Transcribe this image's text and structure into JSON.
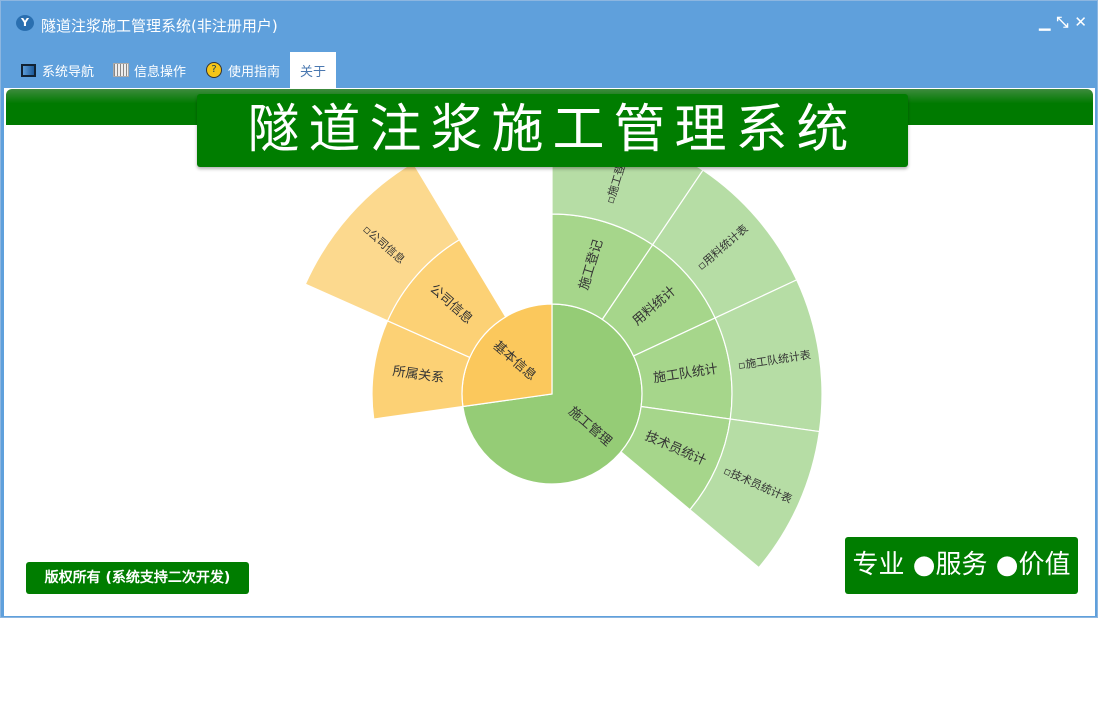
{
  "window": {
    "title": "隧道注浆施工管理系统(非注册用户)",
    "controls": [
      "▁",
      "⤡",
      "✕"
    ]
  },
  "menu": [
    {
      "label": "系统导航",
      "icon": "monitor-icon"
    },
    {
      "label": "信息操作",
      "icon": "grid-icon"
    },
    {
      "label": "使用指南",
      "icon": "help-icon"
    },
    {
      "label": "关于",
      "icon": ""
    }
  ],
  "banner": "隧道注浆施工管理系统",
  "copyright": "版权所有 (系统支持二次开发)",
  "slogan": "专业 ●服务 ●价值",
  "colors": {
    "green": [
      "#95cc76",
      "#a6d68b",
      "#b6dda5"
    ],
    "orange": [
      "#fbc85c",
      "#fcd175",
      "#fcd98e"
    ]
  },
  "chart_data": {
    "type": "sunburst",
    "nodes": [
      {
        "name": "施工管理",
        "group": "green",
        "start": 0,
        "end": 262,
        "children": [
          {
            "name": "施工登记",
            "start": 0,
            "end": 34,
            "children": [
              {
                "name": "▫施工登记",
                "start": 0,
                "end": 34
              }
            ]
          },
          {
            "name": "用料统计",
            "start": 34,
            "end": 65,
            "children": [
              {
                "name": "▫用料统计表",
                "start": 34,
                "end": 65
              }
            ]
          },
          {
            "name": "施工队统计",
            "start": 65,
            "end": 98,
            "children": [
              {
                "name": "▫施工队统计表",
                "start": 65,
                "end": 98
              }
            ]
          },
          {
            "name": "技术员统计",
            "start": 98,
            "end": 130,
            "children": [
              {
                "name": "▫技术员统计表",
                "start": 98,
                "end": 130
              }
            ]
          }
        ]
      },
      {
        "name": "基本信息",
        "group": "orange",
        "start": 262,
        "end": 360,
        "children": [
          {
            "name": "所属关系",
            "start": 262,
            "end": 294,
            "children": []
          },
          {
            "name": "公司信息",
            "start": 294,
            "end": 329,
            "children": [
              {
                "name": "▫公司信息",
                "start": 294,
                "end": 329
              }
            ]
          }
        ]
      }
    ]
  }
}
